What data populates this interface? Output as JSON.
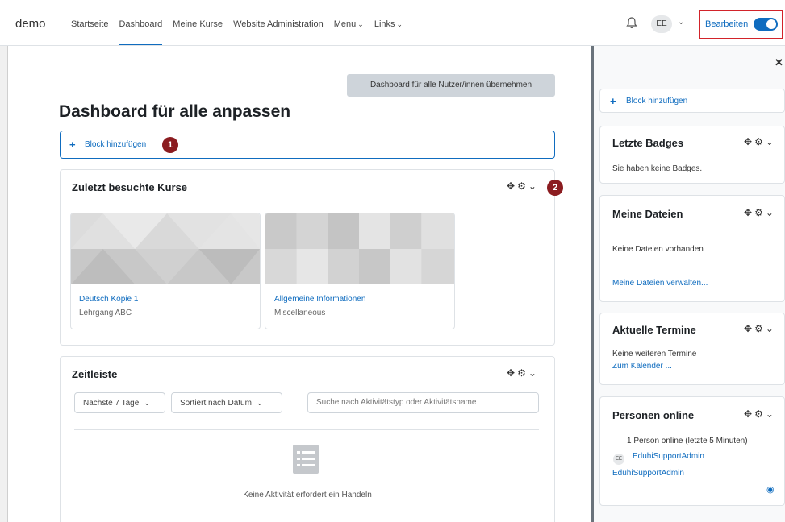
{
  "navbar": {
    "brand": "demo",
    "items": [
      {
        "label": "Startseite"
      },
      {
        "label": "Dashboard",
        "active": true
      },
      {
        "label": "Meine Kurse"
      },
      {
        "label": "Website Administration"
      },
      {
        "label": "Menu",
        "dropdown": true
      },
      {
        "label": "Links",
        "dropdown": true
      }
    ],
    "avatar_initials": "EE",
    "edit_label": "Bearbeiten",
    "edit_mode_on": true
  },
  "main": {
    "reset_button": "Dashboard für alle Nutzer/innen übernehmen",
    "title": "Dashboard für alle anpassen",
    "add_block": "Block hinzufügen",
    "markers": [
      "1",
      "2"
    ]
  },
  "recent_courses": {
    "title": "Zuletzt besuchte Kurse",
    "courses": [
      {
        "name": "Deutsch Kopie 1",
        "category": "Lehrgang ABC"
      },
      {
        "name": "Allgemeine Informationen",
        "category": "Miscellaneous"
      }
    ]
  },
  "timeline": {
    "title": "Zeitleiste",
    "filter_range": "Nächste 7 Tage",
    "sort": "Sortiert nach Datum",
    "search_placeholder": "Suche nach Aktivitätstyp oder Aktivitätsname",
    "empty": "Keine Aktivität erfordert ein Handeln"
  },
  "drawer": {
    "add_block": "Block hinzufügen",
    "badges": {
      "title": "Letzte Badges",
      "text": "Sie haben keine Badges."
    },
    "files": {
      "title": "Meine Dateien",
      "text": "Keine Dateien vorhanden",
      "link": "Meine Dateien verwalten..."
    },
    "events": {
      "title": "Aktuelle Termine",
      "text": "Keine weiteren Termine",
      "link": "Zum Kalender ..."
    },
    "online": {
      "title": "Personen online",
      "text": "1 Person online (letzte 5 Minuten)",
      "user": "EduhiSupportAdmin",
      "user_initials": "EE",
      "user_link": "EduhiSupportAdmin"
    }
  },
  "colors": {
    "accent": "#0f6cbf",
    "highlight_border": "#d2232a",
    "marker": "#8b1c20"
  }
}
